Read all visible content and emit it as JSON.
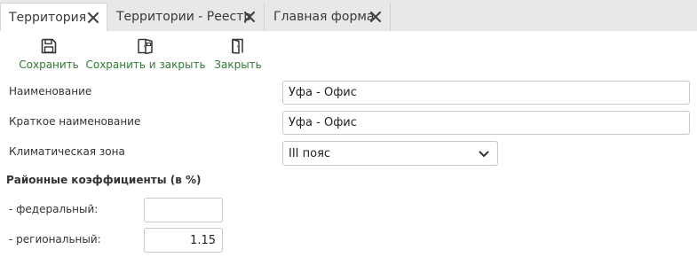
{
  "tabs": [
    {
      "label": "Территория",
      "active": true
    },
    {
      "label": "Территории - Реестр",
      "active": false
    },
    {
      "label": "Главная форма",
      "active": false
    }
  ],
  "toolbar": {
    "save_label": "Сохранить",
    "save_close_label": "Сохранить и закрыть",
    "close_label": "Закрыть",
    "accent_color": "#2e7d32"
  },
  "form": {
    "name_label": "Наименование",
    "name_value": "Уфа - Офис",
    "short_name_label": "Краткое наименование",
    "short_name_value": "Уфа - Офис",
    "climate_zone_label": "Климатическая зона",
    "climate_zone_value": "III пояс",
    "coefficients_title": "Районные коэффициенты (в %)",
    "federal_label": "- федеральный:",
    "federal_value": "",
    "regional_label": "- региональный:",
    "regional_value": "1.15"
  }
}
